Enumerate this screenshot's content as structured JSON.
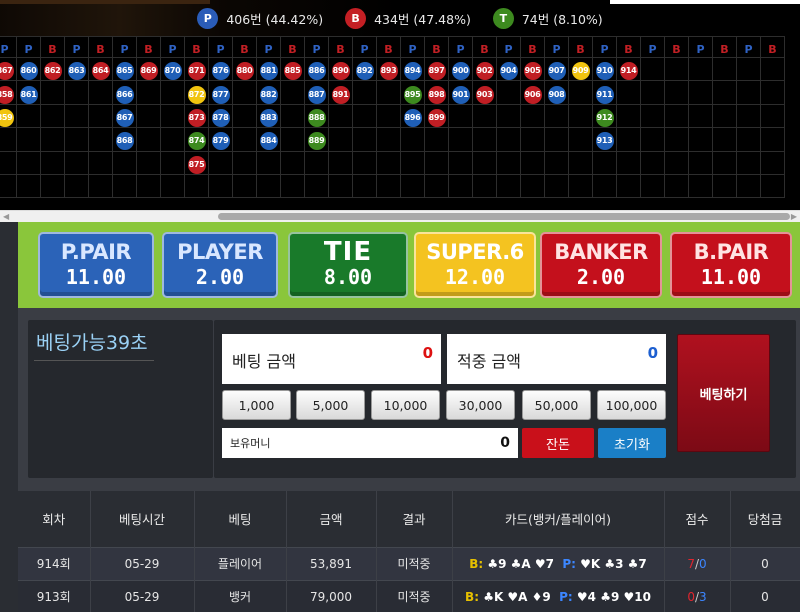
{
  "stats": {
    "player": {
      "letter": "P",
      "text": "406번 (44.42%)",
      "color": "#2a5cb8"
    },
    "banker": {
      "letter": "B",
      "text": "434번 (47.48%)",
      "color": "#c41f24"
    },
    "tie": {
      "letter": "T",
      "text": "74번 (8.10%)",
      "color": "#3d8a1f"
    }
  },
  "road": {
    "header": [
      "P",
      "P",
      "B",
      "P",
      "B",
      "P",
      "B",
      "P",
      "B",
      "P",
      "B",
      "P",
      "B",
      "P",
      "B",
      "P",
      "B",
      "P",
      "B",
      "P",
      "B",
      "P",
      "B",
      "P",
      "B",
      "P",
      "B",
      "P",
      "B",
      "P",
      "B",
      "P",
      "B"
    ],
    "columns": [
      [
        [
          "867",
          "B"
        ],
        [
          "858",
          "B"
        ],
        [
          "859",
          "Y"
        ],
        null,
        null,
        null
      ],
      [
        [
          "860",
          "P"
        ],
        [
          "861",
          "P"
        ],
        null,
        null,
        null,
        null
      ],
      [
        [
          "862",
          "B"
        ],
        null,
        null,
        null,
        null,
        null
      ],
      [
        [
          "863",
          "P"
        ],
        null,
        null,
        null,
        null,
        null
      ],
      [
        [
          "864",
          "B"
        ],
        null,
        null,
        null,
        null,
        null
      ],
      [
        [
          "865",
          "P"
        ],
        [
          "866",
          "P"
        ],
        [
          "867",
          "P"
        ],
        [
          "868",
          "P"
        ],
        null,
        null
      ],
      [
        [
          "869",
          "B"
        ],
        null,
        null,
        null,
        null,
        null
      ],
      [
        [
          "870",
          "P"
        ],
        null,
        null,
        null,
        null,
        null
      ],
      [
        [
          "871",
          "B"
        ],
        [
          "872",
          "Y"
        ],
        [
          "873",
          "B"
        ],
        [
          "874",
          "T"
        ],
        [
          "875",
          "B"
        ],
        null
      ],
      [
        [
          "876",
          "P"
        ],
        [
          "877",
          "P"
        ],
        [
          "878",
          "P"
        ],
        [
          "879",
          "P"
        ],
        null,
        null
      ],
      [
        [
          "880",
          "B"
        ],
        null,
        null,
        null,
        null,
        null
      ],
      [
        [
          "881",
          "P"
        ],
        [
          "882",
          "P"
        ],
        [
          "883",
          "P"
        ],
        [
          "884",
          "P"
        ],
        null,
        null
      ],
      [
        [
          "885",
          "B"
        ],
        null,
        null,
        null,
        null,
        null
      ],
      [
        [
          "886",
          "P"
        ],
        [
          "887",
          "P"
        ],
        [
          "888",
          "T"
        ],
        [
          "889",
          "T"
        ],
        null,
        null
      ],
      [
        [
          "890",
          "B"
        ],
        [
          "891",
          "B"
        ],
        null,
        null,
        null,
        null
      ],
      [
        [
          "892",
          "P"
        ],
        null,
        null,
        null,
        null,
        null
      ],
      [
        [
          "893",
          "B"
        ],
        null,
        null,
        null,
        null,
        null
      ],
      [
        [
          "894",
          "P"
        ],
        [
          "895",
          "T"
        ],
        [
          "896",
          "P"
        ],
        null,
        null,
        null
      ],
      [
        [
          "897",
          "B"
        ],
        [
          "898",
          "B"
        ],
        [
          "899",
          "B"
        ],
        null,
        null,
        null
      ],
      [
        [
          "900",
          "P"
        ],
        [
          "901",
          "P"
        ],
        null,
        null,
        null,
        null
      ],
      [
        [
          "902",
          "B"
        ],
        [
          "903",
          "B"
        ],
        null,
        null,
        null,
        null
      ],
      [
        [
          "904",
          "P"
        ],
        null,
        null,
        null,
        null,
        null
      ],
      [
        [
          "905",
          "B"
        ],
        [
          "906",
          "B"
        ],
        null,
        null,
        null,
        null
      ],
      [
        [
          "907",
          "P"
        ],
        [
          "908",
          "P"
        ],
        null,
        null,
        null,
        null
      ],
      [
        [
          "909",
          "Y"
        ],
        null,
        null,
        null,
        null,
        null
      ],
      [
        [
          "910",
          "P"
        ],
        [
          "911",
          "P"
        ],
        [
          "912",
          "T"
        ],
        [
          "913",
          "P"
        ],
        null,
        null
      ],
      [
        [
          "914",
          "B"
        ],
        null,
        null,
        null,
        null,
        null
      ],
      [
        null,
        null,
        null,
        null,
        null,
        null
      ],
      [
        null,
        null,
        null,
        null,
        null,
        null
      ],
      [
        null,
        null,
        null,
        null,
        null,
        null
      ],
      [
        null,
        null,
        null,
        null,
        null,
        null
      ],
      [
        null,
        null,
        null,
        null,
        null,
        null
      ],
      [
        null,
        null,
        null,
        null,
        null,
        null
      ]
    ]
  },
  "bets": {
    "ppair": {
      "name": "P.PAIR",
      "odds": "11.00"
    },
    "player": {
      "name": "PLAYER",
      "odds": "2.00"
    },
    "tie": {
      "name": "TIE",
      "odds": "8.00"
    },
    "super6": {
      "name": "SUPER.6",
      "odds": "12.00"
    },
    "banker": {
      "name": "BANKER",
      "odds": "2.00"
    },
    "bpair": {
      "name": "B.PAIR",
      "odds": "11.00"
    }
  },
  "panel": {
    "timer": "베팅가능39초",
    "bet_label": "베팅 금액",
    "bet_value": "0",
    "win_label": "적중 금액",
    "win_value": "0",
    "place_bet": "베팅하기",
    "chips": [
      "1,000",
      "5,000",
      "10,000",
      "30,000",
      "50,000",
      "100,000"
    ],
    "money_label": "보유머니",
    "money_value": "0",
    "change_btn": "잔돈",
    "reset_btn": "초기화"
  },
  "history": {
    "headers": [
      "회차",
      "베팅시간",
      "베팅",
      "금액",
      "결과",
      "카드(뱅커/플레이어)",
      "점수",
      "당첨금"
    ],
    "rows": [
      {
        "round": "914회",
        "time": "05-29",
        "bet": "플레이어",
        "amount": "53,891",
        "result": "미적중",
        "cards_b": "♣9 ♣A ♥7",
        "cards_p": "♥K ♣3 ♣7",
        "score_b": "7",
        "score_p": "0",
        "payout": "0"
      },
      {
        "round": "913회",
        "time": "05-29",
        "bet": "뱅커",
        "amount": "79,000",
        "result": "미적중",
        "cards_b": "♣K ♥A ♦9",
        "cards_p": "♥4 ♣9 ♥10",
        "score_b": "0",
        "score_p": "3",
        "payout": "0"
      }
    ]
  }
}
